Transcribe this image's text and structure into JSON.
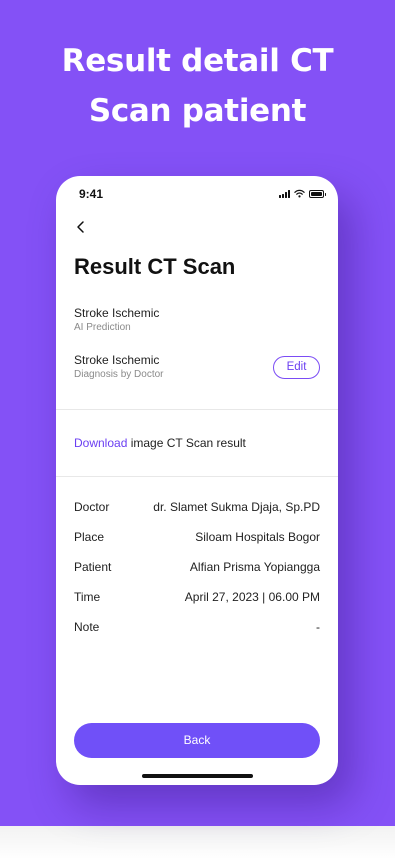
{
  "theme": {
    "accent": "#8451f6",
    "button": "#7050f8",
    "link": "#6b3ff2"
  },
  "headline": {
    "line1": "Result detail CT",
    "line2": "Scan patient"
  },
  "status_bar": {
    "time": "9:41",
    "icons": [
      "signal-icon",
      "wifi-icon",
      "battery-icon"
    ]
  },
  "nav": {
    "back_icon": "chevron-left-icon"
  },
  "screen": {
    "title": "Result CT Scan",
    "ai_prediction": {
      "value": "Stroke Ischemic",
      "caption": "AI Prediction"
    },
    "doctor_diagnosis": {
      "value": "Stroke Ischemic",
      "caption": "Diagnosis by Doctor",
      "edit_label": "Edit"
    },
    "download": {
      "link": "Download",
      "text": " image CT Scan result"
    },
    "details": [
      {
        "label": "Doctor",
        "value": "dr. Slamet Sukma Djaja, Sp.PD"
      },
      {
        "label": "Place",
        "value": "Siloam Hospitals Bogor"
      },
      {
        "label": "Patient",
        "value": "Alfian Prisma Yopiangga"
      },
      {
        "label": "Time",
        "value": "April 27, 2023 | 06.00 PM"
      },
      {
        "label": "Note",
        "value": "-"
      }
    ],
    "back_button": "Back"
  }
}
